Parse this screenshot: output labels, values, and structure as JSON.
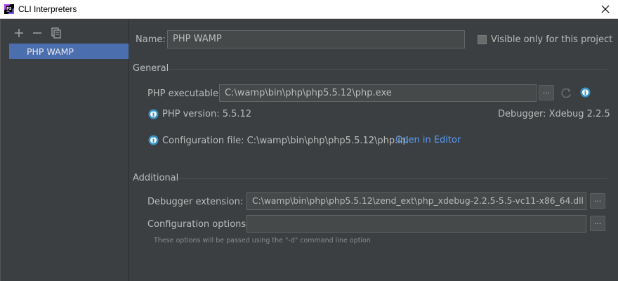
{
  "window": {
    "title": "CLI Interpreters"
  },
  "toolbar": {
    "add_icon": "plus-icon",
    "remove_icon": "minus-icon",
    "copy_icon": "copy-icon"
  },
  "interpreters": {
    "items": [
      {
        "label": "PHP WAMP"
      }
    ]
  },
  "form": {
    "name_label": "Name:",
    "name_value": "PHP WAMP",
    "visible_only_label": "Visible only for this project",
    "general_section": "General",
    "php_executable_label": "PHP executable:",
    "php_executable_value": "C:\\wamp\\bin\\php\\php5.5.12\\php.exe",
    "browse_label": "...",
    "php_version_text": "PHP version: 5.5.12",
    "debugger_text": "Debugger: Xdebug 2.2.5",
    "config_file_text": "Configuration file: C:\\wamp\\bin\\php\\php5.5.12\\php.ini",
    "open_in_editor_label": "Open in Editor",
    "additional_section": "Additional",
    "debugger_extension_label": "Debugger extension:",
    "debugger_extension_value": "C:\\wamp\\bin\\php\\php5.5.12\\zend_ext\\php_xdebug-2.2.5-5.5-vc11-x86_64.dll",
    "config_options_label": "Configuration options:",
    "config_options_value": "",
    "config_options_hint": "These options will be passed using the \"-d\" command line option"
  },
  "colors": {
    "background": "#3c3f41",
    "selection": "#4b6eaf",
    "link": "#589df6",
    "field": "#45494a"
  }
}
